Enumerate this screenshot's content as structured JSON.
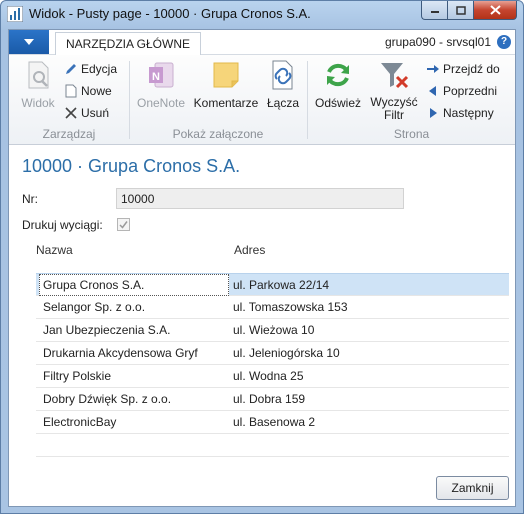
{
  "window": {
    "title": "Widok - Pusty page - 10000 · Grupa Cronos S.A."
  },
  "ribbon": {
    "tab_home": "NARZĘDZIA GŁÓWNE",
    "server": "grupa090 - srvsql01",
    "groups": {
      "zarzadzaj": {
        "label": "Zarządzaj",
        "view": "Widok",
        "edit": "Edycja",
        "new": "Nowe",
        "delete": "Usuń"
      },
      "zalaczone": {
        "label": "Pokaż załączone",
        "onenote": "OneNote",
        "notes": "Komentarze",
        "links": "Łącza"
      },
      "strona": {
        "label": "Strona",
        "refresh": "Odśwież",
        "clear_filter_1": "Wyczyść",
        "clear_filter_2": "Filtr",
        "goto": "Przejdź do",
        "previous": "Poprzedni",
        "next": "Następny"
      }
    }
  },
  "page": {
    "title": "10000 · Grupa Cronos S.A.",
    "nr_label": "Nr:",
    "nr_value": "10000",
    "print_label": "Drukuj wyciągi:",
    "print_checked": true
  },
  "table": {
    "headers": [
      "Nazwa",
      "Adres"
    ],
    "rows": [
      {
        "name": "Grupa Cronos S.A.",
        "address": "ul. Parkowa 22/14"
      },
      {
        "name": "Selangor Sp. z o.o.",
        "address": "ul. Tomaszowska 153"
      },
      {
        "name": "Jan Ubezpieczenia S.A.",
        "address": "ul. Wieżowa 10"
      },
      {
        "name": "Drukarnia Akcydensowa Gryf",
        "address": "ul. Jeleniogórska 10"
      },
      {
        "name": "Filtry Polskie",
        "address": "ul. Wodna 25"
      },
      {
        "name": "Dobry Dźwięk Sp. z o.o.",
        "address": "ul. Dobra 159"
      },
      {
        "name": "ElectronicBay",
        "address": "ul. Basenowa 2"
      }
    ]
  },
  "footer": {
    "close_label": "Zamknij"
  },
  "colors": {
    "accent": "#2c6ea8",
    "selection": "#cfe3f6"
  }
}
